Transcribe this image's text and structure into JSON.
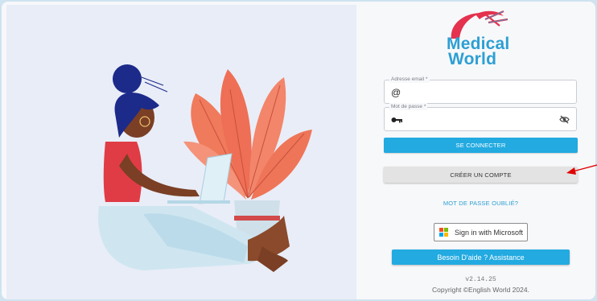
{
  "logo": {
    "line1": "Medical",
    "line2": "World"
  },
  "form": {
    "email": {
      "label": "Adresse email *",
      "icon": "@",
      "value": "",
      "placeholder": ""
    },
    "password": {
      "label": "Mot de passe *",
      "icon": "key-icon",
      "value": "",
      "placeholder": ""
    },
    "login_button": "SE CONNECTER",
    "create_account_button": "CRÉER UN COMPTE",
    "forgot_password": "MOT DE PASSE OUBLIÉ?",
    "microsoft_button": "Sign in with Microsoft",
    "help_button": "Besoin D'aide ? Assistance"
  },
  "footer": {
    "version": "v2.14.25",
    "copyright": "Copyright ©English World 2024."
  },
  "colors": {
    "accent": "#22aae1",
    "brand_blue": "#2d9fd3",
    "brand_red": "#e4324f",
    "left_panel_bg": "#e9edf7",
    "annotation_arrow": "#e00000"
  },
  "icons": [
    "at-icon",
    "key-icon",
    "eye-slash-icon",
    "microsoft-logo-icon"
  ]
}
